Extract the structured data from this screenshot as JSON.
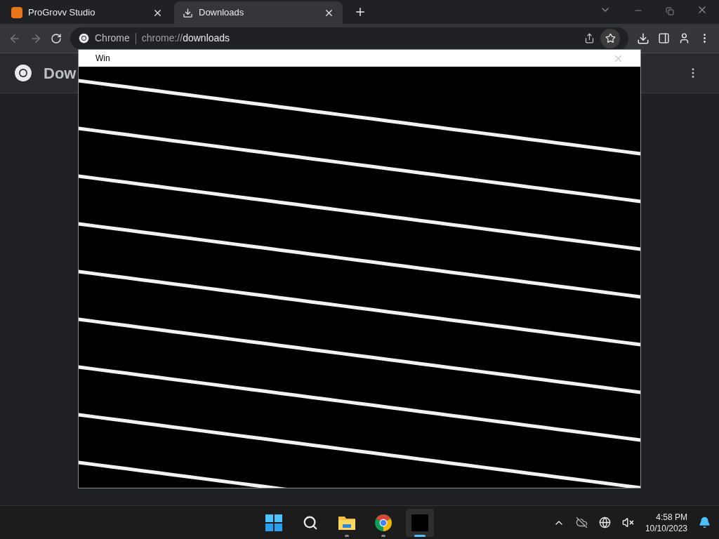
{
  "tabs": [
    {
      "title": "ProGrovv Studio",
      "selected": false
    },
    {
      "title": "Downloads",
      "selected": true
    }
  ],
  "address_bar": {
    "site_label": "Chrome",
    "url_scheme": "chrome://",
    "url_path": "downloads"
  },
  "page": {
    "title": "Dow"
  },
  "window": {
    "title": "Win"
  },
  "taskbar": {
    "apps": [
      {
        "kind": "explorer",
        "running": true,
        "selected": false
      },
      {
        "kind": "chrome",
        "running": true,
        "selected": false
      },
      {
        "kind": "blank",
        "running": true,
        "selected": true
      }
    ],
    "clock": {
      "time": "4:58 PM",
      "date": "10/10/2023"
    }
  }
}
